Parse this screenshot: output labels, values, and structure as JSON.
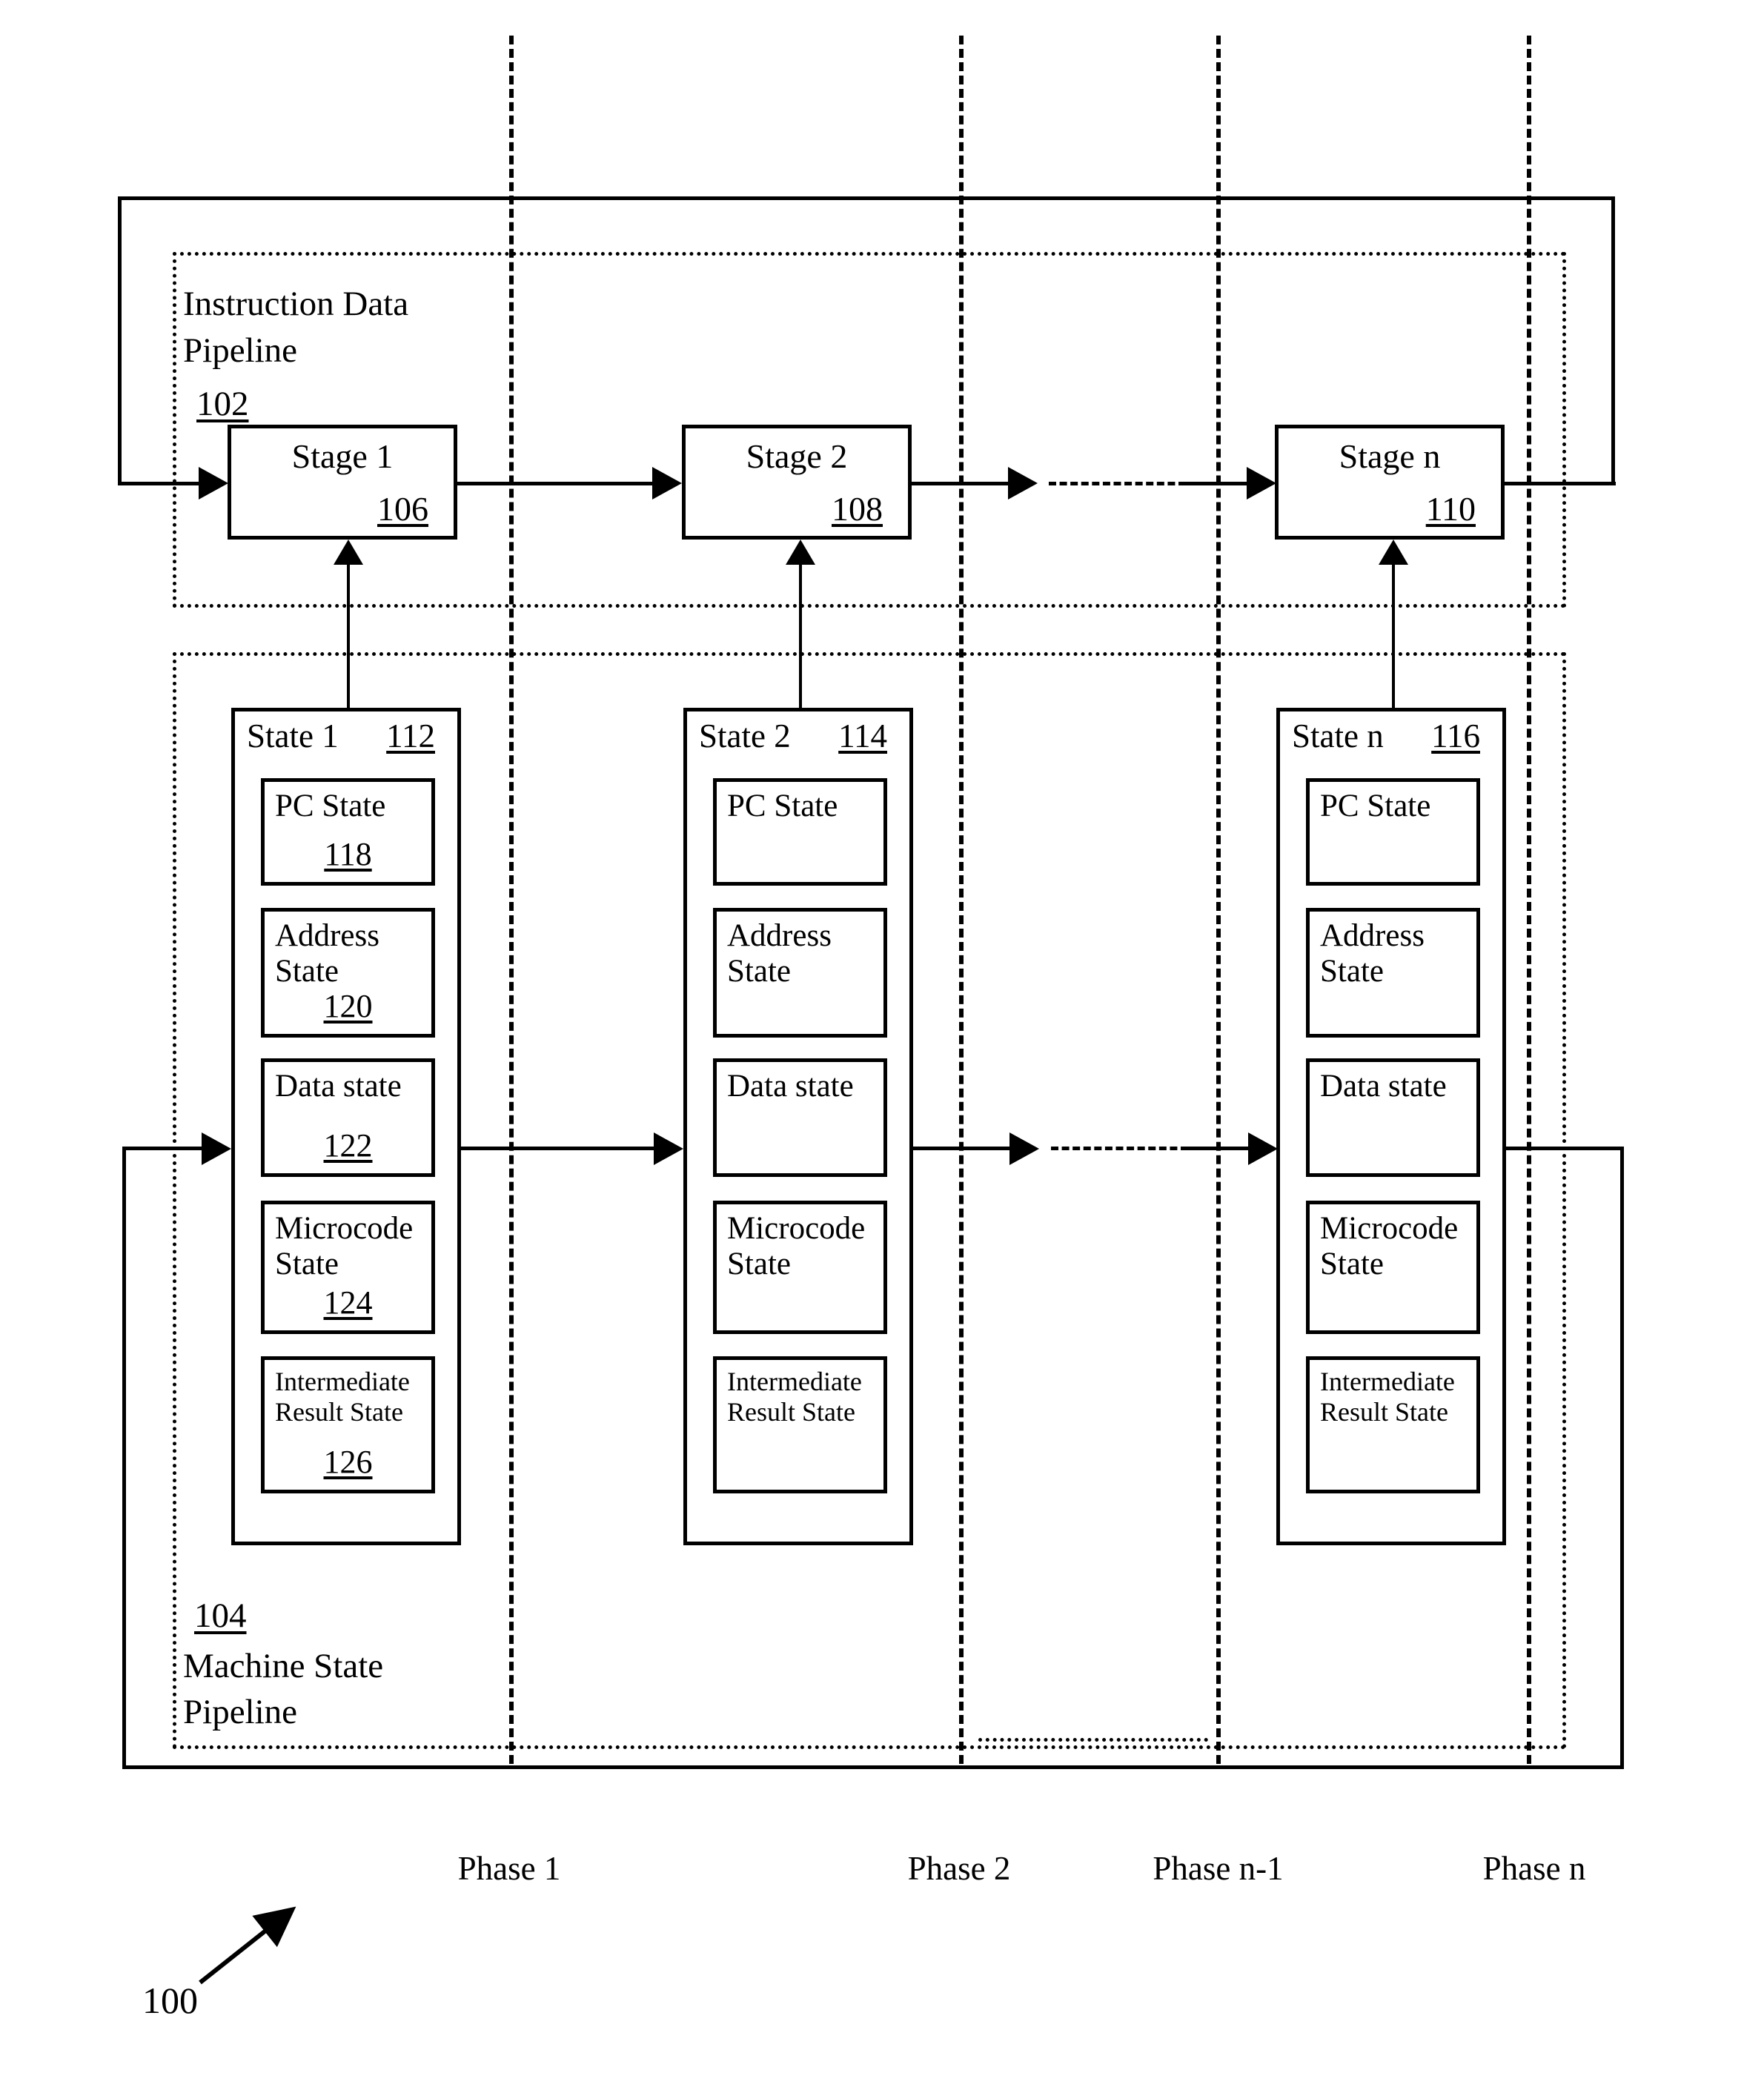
{
  "figure": {
    "number": "100",
    "instruction_pipeline": {
      "title_line1": "Instruction Data",
      "title_line2": "Pipeline",
      "ref": "102"
    },
    "machine_pipeline": {
      "ref": "104",
      "title_line1": "Machine State",
      "title_line2": "Pipeline"
    },
    "stages": [
      {
        "label": "Stage 1",
        "ref": "106"
      },
      {
        "label": "Stage 2",
        "ref": "108"
      },
      {
        "label": "Stage n",
        "ref": "110"
      }
    ],
    "state_columns": [
      {
        "label": "State 1",
        "ref": "112",
        "items": [
          {
            "label": "PC State",
            "ref": "118"
          },
          {
            "label": "Address\nState",
            "ref": "120"
          },
          {
            "label": "Data state",
            "ref": "122"
          },
          {
            "label": "Microcode\nState",
            "ref": "124"
          },
          {
            "label": "Intermediate\nResult State",
            "ref": "126"
          }
        ]
      },
      {
        "label": "State 2",
        "ref": "114",
        "items": [
          {
            "label": "PC State",
            "ref": ""
          },
          {
            "label": "Address\nState",
            "ref": ""
          },
          {
            "label": "Data state",
            "ref": ""
          },
          {
            "label": "Microcode\nState",
            "ref": ""
          },
          {
            "label": "Intermediate\nResult State",
            "ref": ""
          }
        ]
      },
      {
        "label": "State n",
        "ref": "116",
        "items": [
          {
            "label": "PC State",
            "ref": ""
          },
          {
            "label": "Address\nState",
            "ref": ""
          },
          {
            "label": "Data state",
            "ref": ""
          },
          {
            "label": "Microcode\nState",
            "ref": ""
          },
          {
            "label": "Intermediate\nResult State",
            "ref": ""
          }
        ]
      }
    ],
    "phases": [
      {
        "label": "Phase 1"
      },
      {
        "label": "Phase 2"
      },
      {
        "label": "Phase n-1"
      },
      {
        "label": "Phase n"
      }
    ]
  }
}
